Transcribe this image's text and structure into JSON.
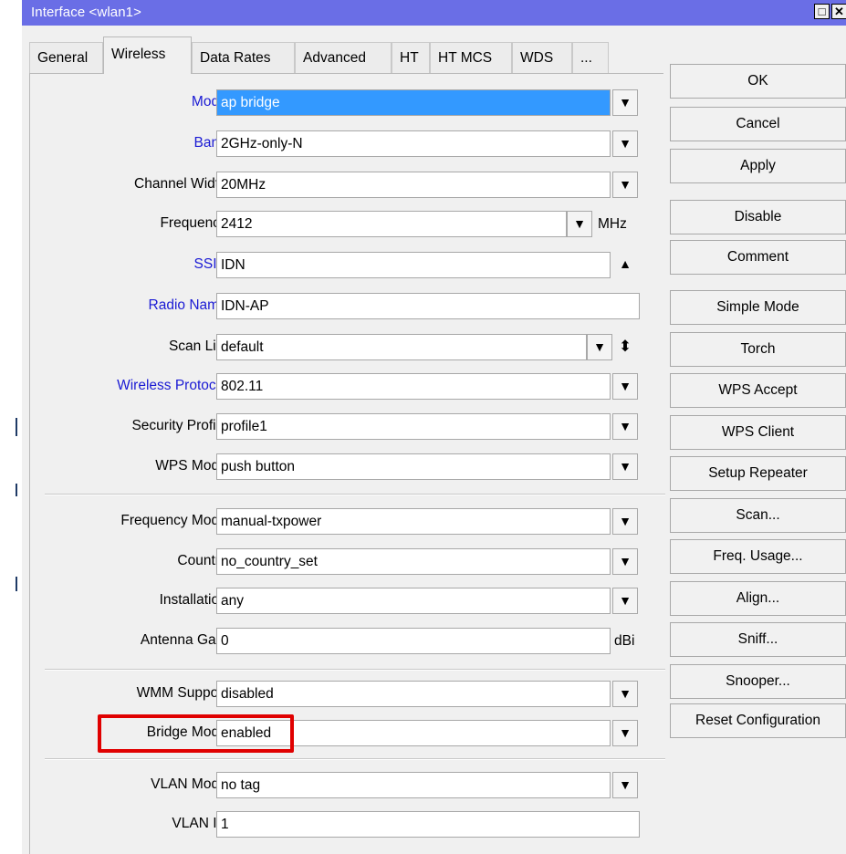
{
  "window": {
    "title": "Interface <wlan1>"
  },
  "tabs": [
    "General",
    "Wireless",
    "Data Rates",
    "Advanced",
    "HT",
    "HT MCS",
    "WDS",
    "..."
  ],
  "active_tab": "Wireless",
  "fields": {
    "mode": {
      "label": "Mode:",
      "value": "ap bridge"
    },
    "band": {
      "label": "Band:",
      "value": "2GHz-only-N"
    },
    "channel_width": {
      "label": "Channel Width:",
      "value": "20MHz"
    },
    "frequency": {
      "label": "Frequency:",
      "value": "2412",
      "unit": "MHz"
    },
    "ssid": {
      "label": "SSID:",
      "value": "IDN"
    },
    "radio_name": {
      "label": "Radio Name:",
      "value": "IDN-AP"
    },
    "scan_list": {
      "label": "Scan List:",
      "value": "default"
    },
    "wireless_protocol": {
      "label": "Wireless Protocol:",
      "value": "802.11"
    },
    "security_profile": {
      "label": "Security Profile:",
      "value": "profile1"
    },
    "wps_mode": {
      "label": "WPS Mode:",
      "value": "push button"
    },
    "frequency_mode": {
      "label": "Frequency Mode:",
      "value": "manual-txpower"
    },
    "country": {
      "label": "Country:",
      "value": "no_country_set"
    },
    "installation": {
      "label": "Installation:",
      "value": "any"
    },
    "antenna_gain": {
      "label": "Antenna Gain:",
      "value": "0",
      "unit": "dBi"
    },
    "wmm_support": {
      "label": "WMM Support:",
      "value": "disabled"
    },
    "bridge_mode": {
      "label": "Bridge Mode:",
      "value": "enabled"
    },
    "vlan_mode": {
      "label": "VLAN Mode:",
      "value": "no tag"
    },
    "vlan_id": {
      "label": "VLAN ID:",
      "value": "1"
    }
  },
  "buttons": {
    "ok": "OK",
    "cancel": "Cancel",
    "apply": "Apply",
    "disable": "Disable",
    "comment": "Comment",
    "simple_mode": "Simple Mode",
    "torch": "Torch",
    "wps_accept": "WPS Accept",
    "wps_client": "WPS Client",
    "setup_repeater": "Setup Repeater",
    "scan": "Scan...",
    "freq_usage": "Freq. Usage...",
    "align": "Align...",
    "sniff": "Sniff...",
    "snooper": "Snooper...",
    "reset_configuration": "Reset Configuration"
  },
  "colors": {
    "titlebar": "#6a6ee6",
    "label_link": "#1a1ad4",
    "selection": "#3399ff",
    "highlight_box": "#e00000"
  },
  "icons": {
    "dropdown": "dropdown-arrow-icon",
    "collapse": "triangle-up-icon",
    "updown": "up-down-arrows-icon",
    "maximize": "maximize-icon",
    "close": "close-icon"
  }
}
